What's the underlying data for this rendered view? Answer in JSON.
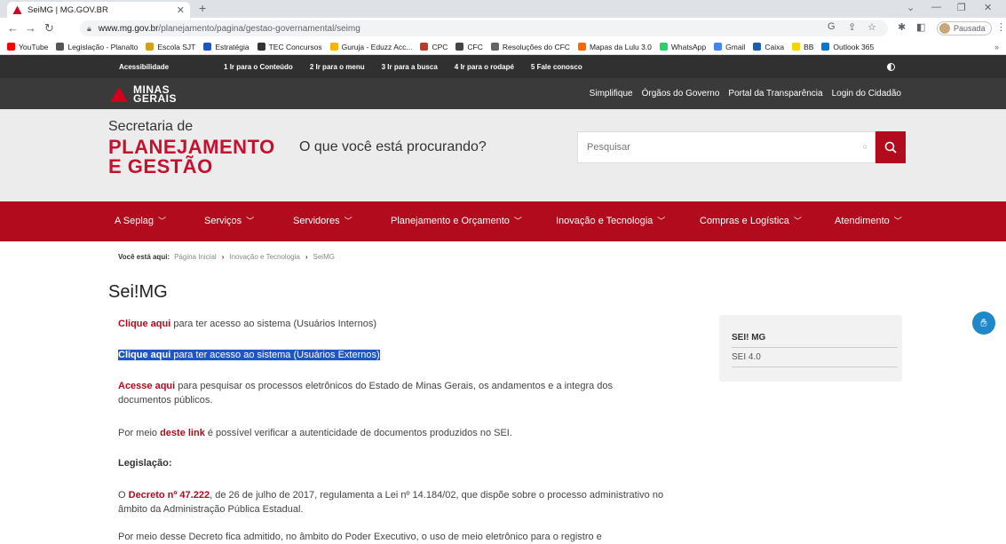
{
  "browser": {
    "tab_title": "SeiMG | MG.GOV.BR",
    "url_host": "www.mg.gov.br",
    "url_path": "/planejamento/pagina/gestao-governamental/seimg",
    "profile_label": "Pausada",
    "bookmarks": [
      {
        "label": "YouTube",
        "color": "#ff0000"
      },
      {
        "label": "Legislação - Planalto",
        "color": "#555555"
      },
      {
        "label": "Escola SJT",
        "color": "#d4a017"
      },
      {
        "label": "Estratégia",
        "color": "#1a56c8"
      },
      {
        "label": "TEC Concursos",
        "color": "#333333"
      },
      {
        "label": "Guruja - Eduzz Acc...",
        "color": "#f7b500"
      },
      {
        "label": "CPC",
        "color": "#c0392b"
      },
      {
        "label": "CFC",
        "color": "#444444"
      },
      {
        "label": "Resoluções do CFC",
        "color": "#666666"
      },
      {
        "label": "Mapas da Lulu 3.0",
        "color": "#ff6600"
      },
      {
        "label": "WhatsApp",
        "color": "#25d366"
      },
      {
        "label": "Gmail",
        "color": "#4285f4"
      },
      {
        "label": "Caixa",
        "color": "#1c60ab"
      },
      {
        "label": "BB",
        "color": "#f5d300"
      },
      {
        "label": "Outlook 365",
        "color": "#0078d4"
      }
    ]
  },
  "accessibility": {
    "links": [
      "Acessibilidade",
      "1 Ir para o Conteúdo",
      "2 Ir para o menu",
      "3 Ir para a busca",
      "4 Ir para o rodapé",
      "5 Fale conosco"
    ]
  },
  "logo": {
    "line1": "MINAS",
    "line2": "GERAIS"
  },
  "top_links": [
    "Simplifique",
    "Órgãos do Governo",
    "Portal da Transparência",
    "Login do Cidadão"
  ],
  "header": {
    "secretaria": "Secretaria de",
    "planejamento": "PLANEJAMENTO",
    "gestao": "E GESTÃO",
    "question": "O que você está procurando?",
    "search_placeholder": "Pesquisar"
  },
  "nav": [
    "A Seplag",
    "Serviços",
    "Servidores",
    "Planejamento e Orçamento",
    "Inovação e Tecnologia",
    "Compras e Logística",
    "Atendimento"
  ],
  "breadcrumb": {
    "label": "Você está aqui:",
    "items": [
      "Página Inicial",
      "Inovação e Tecnologia",
      "SeiMG"
    ]
  },
  "page_title": "Sei!MG",
  "content": {
    "p1_link": "Clique aqui",
    "p1_text": " para ter acesso ao sistema (Usuários Internos)",
    "p2_link": "Clique aqui",
    "p2_text": " para ter acesso ao sistema (Usuários Externos)",
    "p3_link": "Acesse aqui",
    "p3_text": " para pesquisar os processos eletrônicos do Estado de Minas Gerais, os andamentos e a integra dos documentos públicos.",
    "p4_pre": "Por meio ",
    "p4_link": "deste link",
    "p4_text": " é possível verificar a autenticidade de documentos produzidos no SEI.",
    "legislacao": "Legislação:",
    "p5_pre": "O ",
    "p5_link": "Decreto nº 47.222",
    "p5_text": ", de 26 de julho de 2017, regulamenta a Lei nº 14.184/02, que dispõe sobre o processo administrativo no âmbito da Administração Pública Estadual.",
    "p6_text": "Por meio desse Decreto fica admitido, no âmbito do Poder Executivo, o uso de meio eletrônico para o registro e"
  },
  "sidebox": {
    "heading": "SEI! MG",
    "version": "SEI 4.0"
  }
}
